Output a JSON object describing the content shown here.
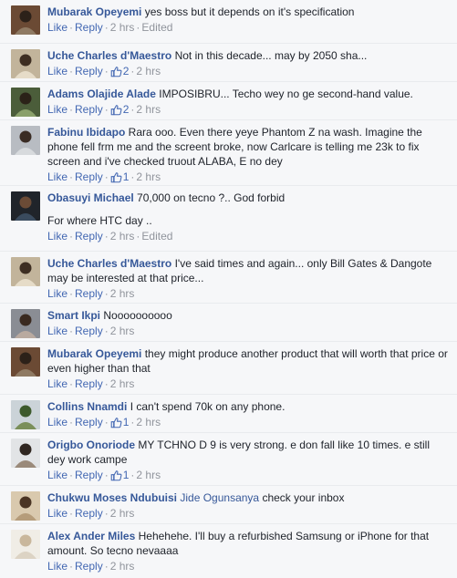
{
  "labels": {
    "like": "Like",
    "reply": "Reply",
    "edited": "Edited",
    "sep": "·"
  },
  "colors": {
    "link": "#365899",
    "action": "#4267b2",
    "meta": "#90949c",
    "bg": "#f6f7f9"
  },
  "comments": [
    {
      "author": "Mubarak Opeyemi",
      "text": "yes boss but it depends on it's specification",
      "likes": "",
      "time": "2 hrs",
      "edited": true
    },
    {
      "author": "Uche Charles d'Maestro",
      "text": "Not in this decade... may by 2050 sha...",
      "likes": "2",
      "time": "2 hrs",
      "edited": false
    },
    {
      "author": "Adams Olajide Alade",
      "text": "IMPOSIBRU... Techo wey no ge second-hand value.",
      "likes": "2",
      "time": "2 hrs",
      "edited": false
    },
    {
      "author": "Fabinu Ibidapo",
      "text": "Rara ooo. Even there yeye Phantom Z na wash. Imagine the phone fell frm me and the screent broke, now Carlcare is telling me 23k to fix screen and i've checked truout ALABA, E no dey",
      "likes": "1",
      "time": "2 hrs",
      "edited": false
    },
    {
      "author": "Obasuyi Michael",
      "text": "70,000 on tecno ?.. God forbid",
      "text2": "For where HTC day ..",
      "likes": "",
      "time": "2 hrs",
      "edited": true
    },
    {
      "author": "Uche Charles d'Maestro",
      "text": "I've said times and again... only Bill Gates & Dangote may be interested at that price...",
      "likes": "",
      "time": "2 hrs",
      "edited": false
    },
    {
      "author": "Smart Ikpi",
      "text": "Noooooooooo",
      "likes": "",
      "time": "2 hrs",
      "edited": false
    },
    {
      "author": "Mubarak Opeyemi",
      "text": "they might produce another product that will worth that price or even higher than that",
      "likes": "",
      "time": "2 hrs",
      "edited": false
    },
    {
      "author": "Collins Nnamdi",
      "text": "I can't spend 70k on any phone.",
      "likes": "1",
      "time": "2 hrs",
      "edited": false
    },
    {
      "author": "Origbo Onoriode",
      "text": "MY TCHNO D 9 is very strong. e don fall like 10 times. e still dey work campe",
      "likes": "1",
      "time": "2 hrs",
      "edited": false
    },
    {
      "author": "Chukwu Moses Ndubuisi",
      "mention": "Jide Ogunsanya",
      "text": "check your inbox",
      "likes": "",
      "time": "2 hrs",
      "edited": false
    },
    {
      "author": "Alex Ander Miles",
      "text": "Hehehehe. I'll buy a refurbished Samsung or iPhone for that amount. So tecno nevaaaa",
      "likes": "",
      "time": "2 hrs",
      "edited": false
    }
  ]
}
